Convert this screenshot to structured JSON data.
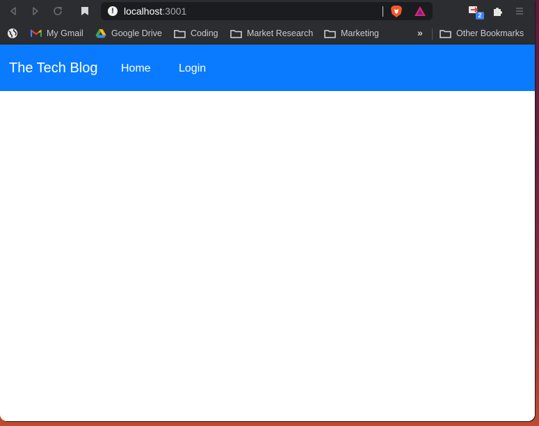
{
  "browser": {
    "url_host": "localhost",
    "url_port": ":3001",
    "extension_badge_count": "2",
    "icons": {
      "back": "back-arrow-icon",
      "forward": "forward-arrow-icon",
      "reload": "reload-icon",
      "bookmark": "bookmark-icon",
      "site_info": "not-secure-warning-icon",
      "shields": "brave-shields-icon",
      "rewards": "brave-rewards-icon",
      "extensions": "puzzle-extensions-icon",
      "menu": "hamburger-menu-icon"
    }
  },
  "bookmarks": {
    "items": [
      {
        "label": "",
        "icon": "globe-icon"
      },
      {
        "label": "My Gmail",
        "icon": "gmail-icon"
      },
      {
        "label": "Google Drive",
        "icon": "google-drive-icon"
      },
      {
        "label": "Coding",
        "icon": "folder-icon"
      },
      {
        "label": "Market Research",
        "icon": "folder-icon"
      },
      {
        "label": "Marketing",
        "icon": "folder-icon"
      }
    ],
    "overflow_label": "»",
    "other_label": "Other Bookmarks"
  },
  "site": {
    "brand": "The Tech Blog",
    "nav": [
      {
        "label": "Home"
      },
      {
        "label": "Login"
      }
    ],
    "accent_color": "#0a7bff"
  }
}
